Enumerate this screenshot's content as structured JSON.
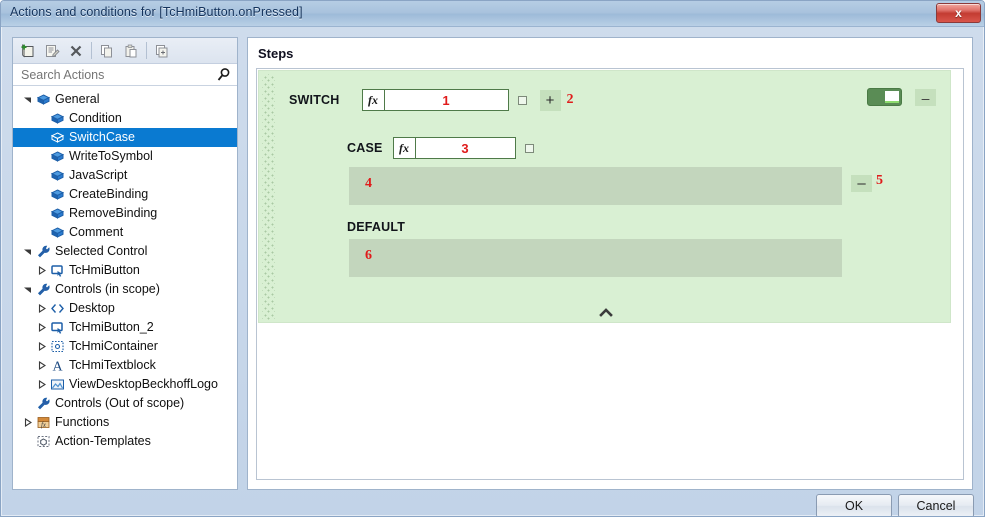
{
  "window": {
    "title": "Actions and conditions for [TcHmiButton.onPressed]",
    "close_label": "x"
  },
  "toolbar": {
    "buttons": [
      {
        "name": "new-action-icon",
        "tooltip": "New"
      },
      {
        "name": "edit-action-icon",
        "tooltip": "Edit"
      },
      {
        "name": "delete-action-icon",
        "tooltip": "Delete"
      },
      {
        "name": "copy-icon",
        "tooltip": "Copy"
      },
      {
        "name": "paste-icon",
        "tooltip": "Paste"
      },
      {
        "name": "duplicate-icon",
        "tooltip": "Duplicate"
      }
    ]
  },
  "search": {
    "placeholder": "Search Actions",
    "value": ""
  },
  "tree": {
    "items": [
      {
        "label": "General",
        "indent": 0,
        "twisty": "expanded",
        "icon": "action-cube-icon",
        "selected": false
      },
      {
        "label": "Condition",
        "indent": 1,
        "twisty": "none",
        "icon": "action-cube-icon",
        "selected": false
      },
      {
        "label": "SwitchCase",
        "indent": 1,
        "twisty": "none",
        "icon": "action-cube-icon",
        "selected": true
      },
      {
        "label": "WriteToSymbol",
        "indent": 1,
        "twisty": "none",
        "icon": "action-cube-icon",
        "selected": false
      },
      {
        "label": "JavaScript",
        "indent": 1,
        "twisty": "none",
        "icon": "action-cube-icon",
        "selected": false
      },
      {
        "label": "CreateBinding",
        "indent": 1,
        "twisty": "none",
        "icon": "action-cube-icon",
        "selected": false
      },
      {
        "label": "RemoveBinding",
        "indent": 1,
        "twisty": "none",
        "icon": "action-cube-icon",
        "selected": false
      },
      {
        "label": "Comment",
        "indent": 1,
        "twisty": "none",
        "icon": "action-cube-icon",
        "selected": false
      },
      {
        "label": "Selected Control",
        "indent": 0,
        "twisty": "expanded",
        "icon": "wrench-icon",
        "selected": false
      },
      {
        "label": "TcHmiButton",
        "indent": 1,
        "twisty": "collapsed",
        "icon": "button-control-icon",
        "selected": false
      },
      {
        "label": "Controls (in scope)",
        "indent": 0,
        "twisty": "expanded",
        "icon": "wrench-icon",
        "selected": false
      },
      {
        "label": "Desktop",
        "indent": 1,
        "twisty": "collapsed",
        "icon": "code-brackets-icon",
        "selected": false
      },
      {
        "label": "TcHmiButton_2",
        "indent": 1,
        "twisty": "collapsed",
        "icon": "button-control-icon",
        "selected": false
      },
      {
        "label": "TcHmiContainer",
        "indent": 1,
        "twisty": "collapsed",
        "icon": "container-icon",
        "selected": false
      },
      {
        "label": "TcHmiTextblock",
        "indent": 1,
        "twisty": "collapsed",
        "icon": "text-a-icon",
        "selected": false
      },
      {
        "label": "ViewDesktopBeckhoffLogo",
        "indent": 1,
        "twisty": "collapsed",
        "icon": "image-icon",
        "selected": false
      },
      {
        "label": "Controls (Out of scope)",
        "indent": 0,
        "twisty": "none",
        "icon": "wrench-icon",
        "selected": false
      },
      {
        "label": "Functions",
        "indent": 0,
        "twisty": "collapsed",
        "icon": "functions-fx-icon",
        "selected": false
      },
      {
        "label": "Action-Templates",
        "indent": 0,
        "twisty": "none",
        "icon": "template-icon",
        "selected": false
      }
    ]
  },
  "steps": {
    "title": "Steps",
    "switch": {
      "keyword": "SWITCH",
      "fx_label": "fx",
      "expression_value": "1",
      "checkbox_checked": false,
      "add_case_label": "+",
      "add_case_marker": "2",
      "toggle_enabled": true,
      "remove_label": "–"
    },
    "case": {
      "keyword": "CASE",
      "fx_label": "fx",
      "expression_value": "3",
      "checkbox_checked": false,
      "dropzone_marker": "4",
      "remove_label": "–",
      "remove_marker": "5"
    },
    "default": {
      "keyword": "DEFAULT",
      "dropzone_marker": "6"
    },
    "collapse_icon": "chevron-up-icon"
  },
  "footer": {
    "ok_label": "OK",
    "cancel_label": "Cancel"
  },
  "colors": {
    "accent_blue": "#0a7ad1",
    "step_green": "#d9f0d3",
    "dropzone_green": "#c3d6bd",
    "marker_red": "#e01b1b",
    "toggle_on": "#5a8c55"
  }
}
